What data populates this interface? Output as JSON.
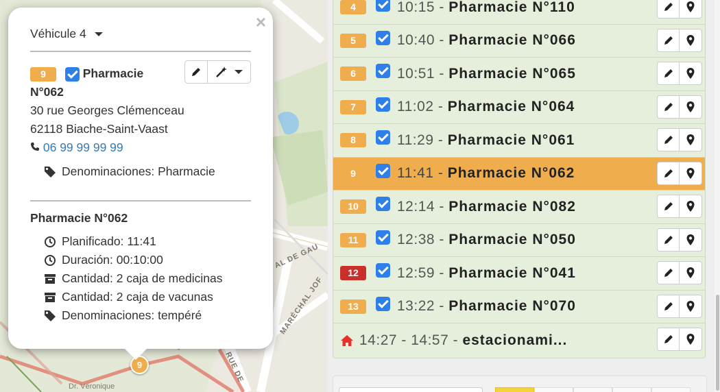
{
  "popup": {
    "close_label": "×",
    "vehicle_label": "Véhicule 4",
    "stop_index": "9",
    "stop_name_part1": "Pharmacie",
    "stop_name_part2": "N°062",
    "address_line1": "30 rue Georges Clémenceau",
    "address_line2": "62118 Biache-Saint-Vaast",
    "phone": "06 99 99 99 99",
    "denominations": "Denominaciones: Pharmacie",
    "section_title": "Pharmacie N°062",
    "planned": "Planificado: 11:41",
    "duration": "Duración: 00:10:00",
    "quantity1": "Cantidad: 2 caja de medicinas",
    "quantity2": "Cantidad: 2 caja de vacunas",
    "denominations2": "Denominaciones: tempéré"
  },
  "map": {
    "marker_label": "9",
    "street1": "AL DE GAU",
    "street2": "MARÉCHAL JOF",
    "street3": "RUE DE",
    "street4": "Dr. Véronique"
  },
  "stops": [
    {
      "index": "4",
      "time": "10:15",
      "name": "Pharmacie N°110",
      "color": "orange",
      "active": false
    },
    {
      "index": "5",
      "time": "10:40",
      "name": "Pharmacie N°066",
      "color": "orange",
      "active": false
    },
    {
      "index": "6",
      "time": "10:51",
      "name": "Pharmacie N°065",
      "color": "orange",
      "active": false
    },
    {
      "index": "7",
      "time": "11:02",
      "name": "Pharmacie N°064",
      "color": "orange",
      "active": false
    },
    {
      "index": "8",
      "time": "11:29",
      "name": "Pharmacie N°061",
      "color": "orange",
      "active": false
    },
    {
      "index": "9",
      "time": "11:41",
      "name": "Pharmacie N°062",
      "color": "orange",
      "active": true
    },
    {
      "index": "10",
      "time": "12:14",
      "name": "Pharmacie N°082",
      "color": "orange",
      "active": false
    },
    {
      "index": "11",
      "time": "12:38",
      "name": "Pharmacie N°050",
      "color": "orange",
      "active": false
    },
    {
      "index": "12",
      "time": "12:59",
      "name": "Pharmacie N°041",
      "color": "red",
      "active": false
    },
    {
      "index": "13",
      "time": "13:22",
      "name": "Pharmacie N°070",
      "color": "orange",
      "active": false
    }
  ],
  "separator": "-",
  "home_row": {
    "time_range": "14:27 - 14:57 -",
    "name": "estacionami..."
  },
  "colors": {
    "badge_orange": "#f0ad4e",
    "badge_red": "#c9302c",
    "checkbox": "#2f7fe8",
    "home_icon": "#e8312b",
    "phone_link": "#337ab7"
  }
}
